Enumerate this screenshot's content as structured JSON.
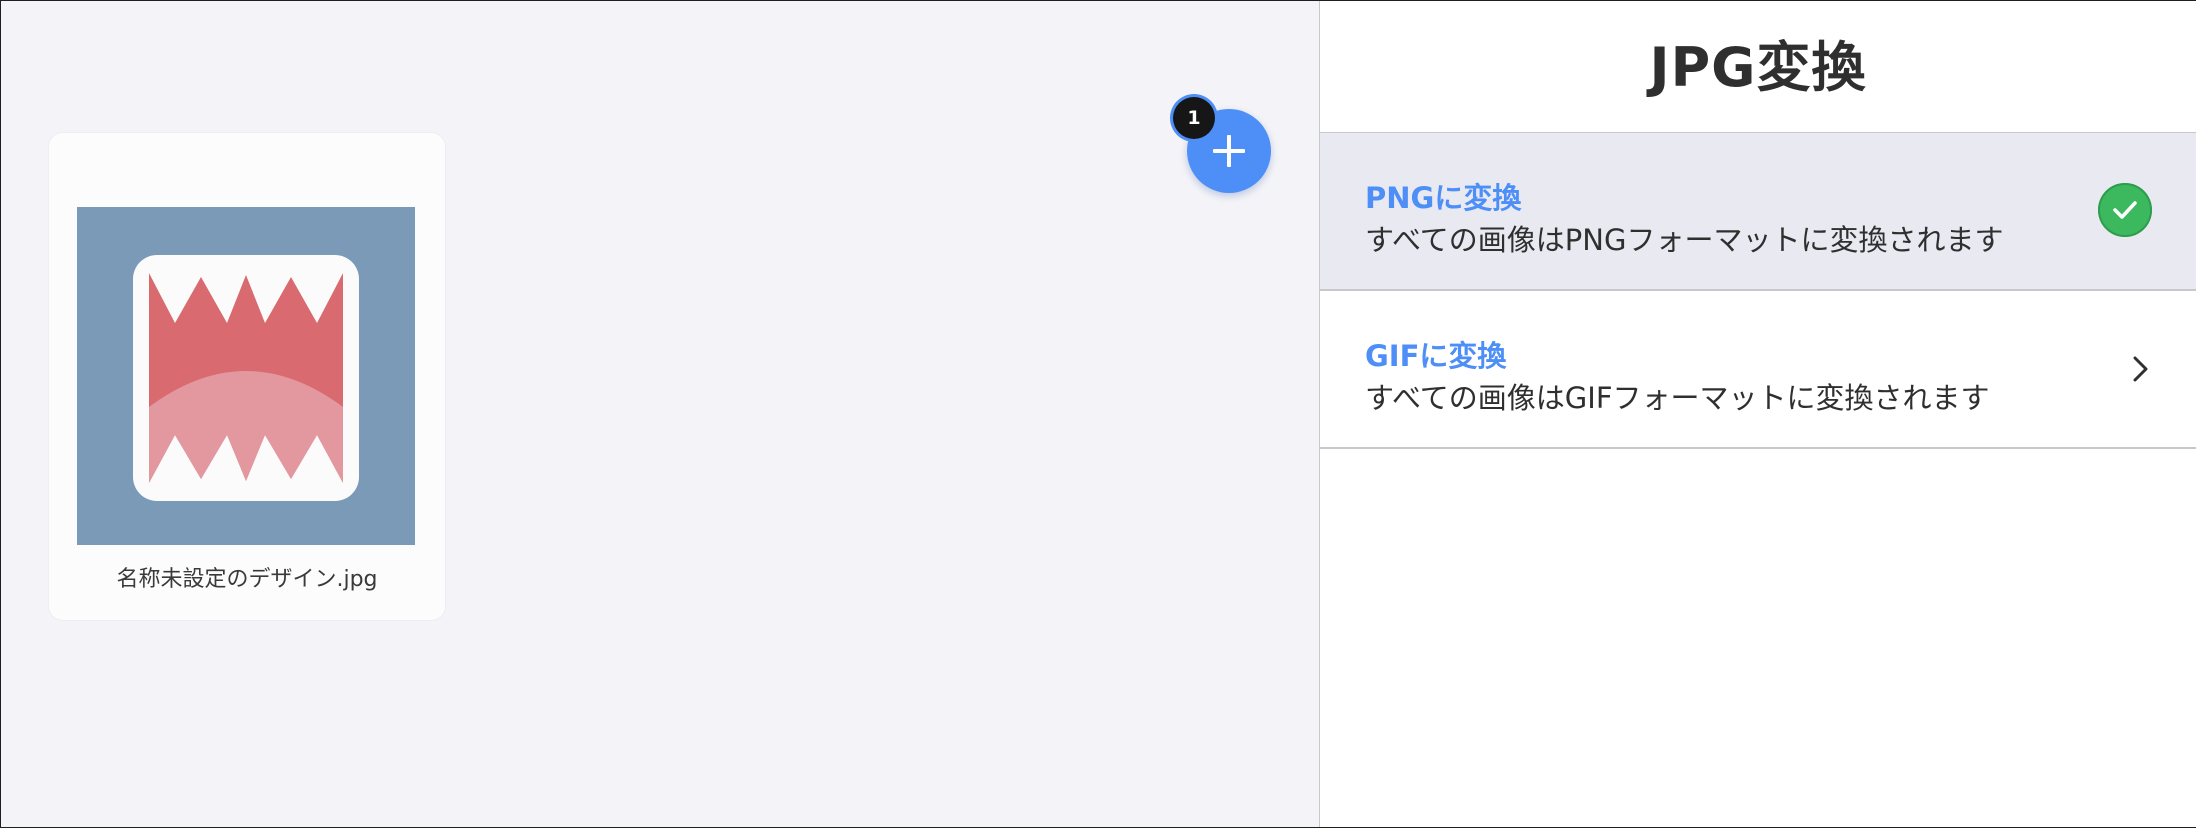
{
  "workspace": {
    "file": {
      "name": "名称未設定のデザイン.jpg",
      "thumbnail_icon": "shark-mouth-image"
    },
    "add_button": {
      "icon": "plus-icon",
      "badge_count": "1"
    }
  },
  "panel": {
    "title": "JPG変換",
    "options": [
      {
        "title": "PNGに変換",
        "description": "すべての画像はPNGフォーマットに変換されます",
        "state": "selected",
        "icon": "check-circle-icon"
      },
      {
        "title": "GIFに変換",
        "description": "すべての画像はGIFフォーマットに変換されます",
        "state": "default",
        "icon": "chevron-right-icon"
      }
    ]
  },
  "colors": {
    "accent": "#4d8ff7",
    "success": "#3cb95f",
    "selected_row": "#e9e9f2",
    "workspace_bg": "#f4f4f8"
  }
}
